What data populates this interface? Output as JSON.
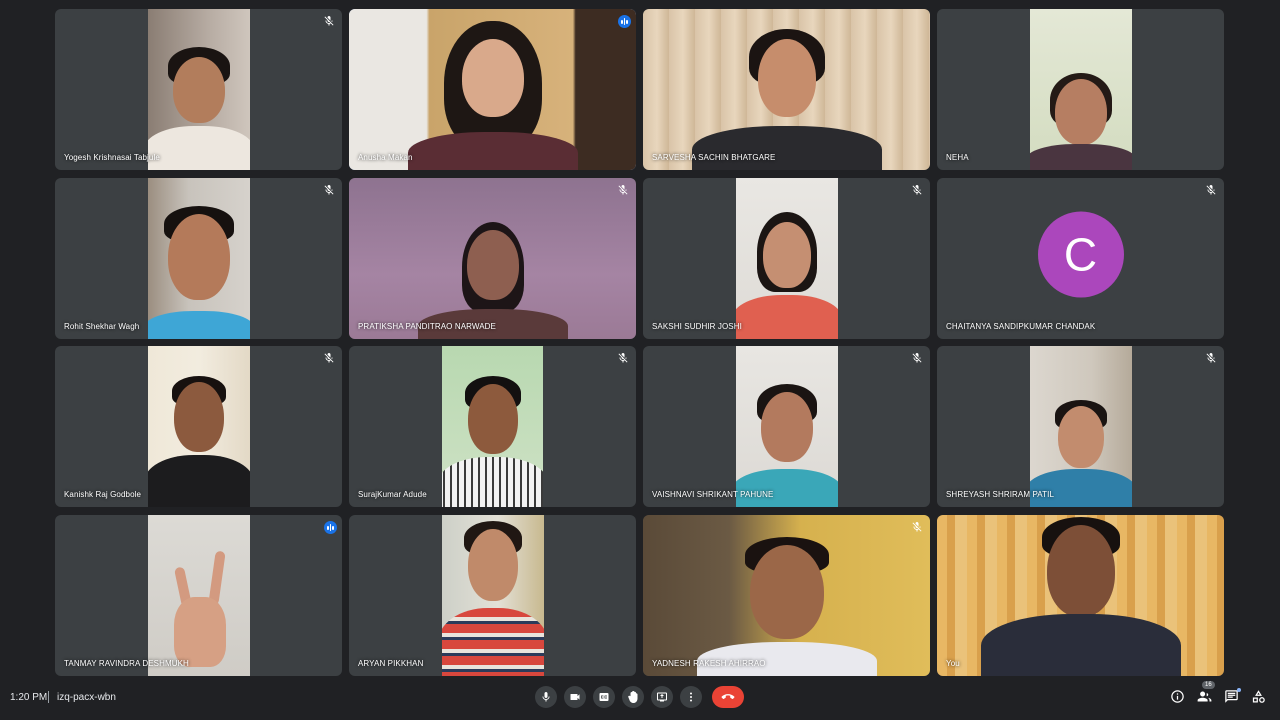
{
  "meeting": {
    "time": "1:20 PM",
    "code": "izq-pacx-wbn",
    "participant_count": "16"
  },
  "participants": [
    {
      "name": "Yogesh Krishnasai Tabjule",
      "muted": true,
      "speaking": false
    },
    {
      "name": "Anusha Makan",
      "muted": false,
      "speaking": true
    },
    {
      "name": "SARVESHA SACHIN BHATGARE",
      "muted": false,
      "speaking": false
    },
    {
      "name": "NEHA",
      "muted": false,
      "speaking": false
    },
    {
      "name": "Rohit Shekhar Wagh",
      "muted": true,
      "speaking": false
    },
    {
      "name": "PRATIKSHA PANDITRAO NARWADE",
      "muted": true,
      "speaking": false
    },
    {
      "name": "SAKSHI SUDHIR JOSHI",
      "muted": true,
      "speaking": false
    },
    {
      "name": "CHAITANYA SANDIPKUMAR CHANDAK",
      "muted": true,
      "speaking": false,
      "avatar_letter": "C",
      "avatar_color": "#ab47bc"
    },
    {
      "name": "Kanishk Raj Godbole",
      "muted": true,
      "speaking": false
    },
    {
      "name": "SurajKumar Adude",
      "muted": true,
      "speaking": false
    },
    {
      "name": "VAISHNAVI SHRIKANT PAHUNE",
      "muted": true,
      "speaking": false
    },
    {
      "name": "SHREYASH SHRIRAM PATIL",
      "muted": true,
      "speaking": false
    },
    {
      "name": "TANMAY RAVINDRA DESHMUKH",
      "muted": false,
      "speaking": true
    },
    {
      "name": "ARYAN PIKKHAN",
      "muted": false,
      "speaking": false
    },
    {
      "name": "YADNESH RAKESH AHIRRAO",
      "muted": true,
      "speaking": false
    },
    {
      "name": "You",
      "muted": false,
      "speaking": false
    }
  ],
  "controls": [
    "mic-icon",
    "camera-icon",
    "captions-icon",
    "raise-hand-icon",
    "present-icon",
    "more-icon",
    "end-call-icon"
  ],
  "right_icons": [
    "info-icon",
    "people-icon",
    "chat-icon",
    "activities-icon"
  ],
  "colors": {
    "background": "#202124",
    "tile": "#3c4043",
    "accent": "#1a73e8",
    "end_call": "#ea4335"
  }
}
